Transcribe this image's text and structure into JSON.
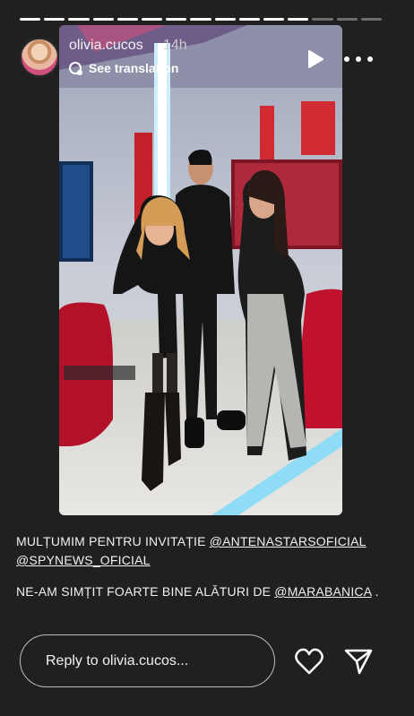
{
  "progress": {
    "total": 15,
    "done": 12
  },
  "header": {
    "username": "olivia.cucos",
    "time": "14h",
    "translate_label": "See translation"
  },
  "caption": {
    "line1_text": "MULȚUMIM PENTRU INVITAȚIE ",
    "line1_mention1": "@ANTENASTARSOFICIAL",
    "line1_mention2": "@SPYNEWS_OFICIAL",
    "line2_text": "NE-AM SIMȚIT FOARTE BINE ALĂTURI DE ",
    "line2_mention": "@MARABANICA",
    "line2_end": " ."
  },
  "reply": {
    "placeholder": "Reply to olivia.cucos..."
  },
  "icons": {
    "play": "play-icon",
    "more": "more-icon",
    "heart": "heart-icon",
    "send": "send-icon",
    "translate": "translate-icon"
  },
  "colors": {
    "background": "#202020",
    "text": "#f1f1f1"
  }
}
